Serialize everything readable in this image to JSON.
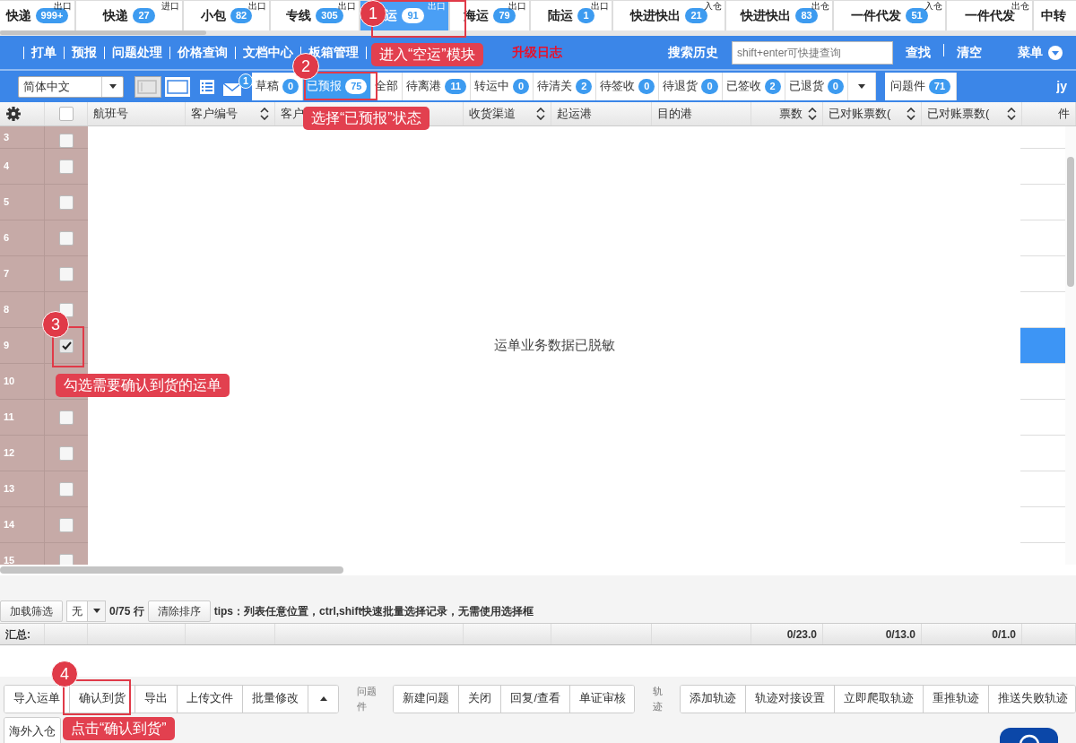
{
  "top_tabs": [
    {
      "label": "快递",
      "count": "999+",
      "tag": "出口",
      "selected": false
    },
    {
      "label": "快递",
      "count": "27",
      "tag": "进口",
      "selected": false
    },
    {
      "label": "小包",
      "count": "82",
      "tag": "出口",
      "selected": false
    },
    {
      "label": "专线",
      "count": "305",
      "tag": "出口",
      "selected": false
    },
    {
      "label": "运",
      "count": "91",
      "tag": "出口",
      "selected": true
    },
    {
      "label": "海运",
      "count": "79",
      "tag": "出口",
      "selected": false
    },
    {
      "label": "陆运",
      "count": "1",
      "tag": "出口",
      "selected": false
    },
    {
      "label": "快进快出",
      "count": "21",
      "tag": "入仓",
      "selected": false
    },
    {
      "label": "快进快出",
      "count": "83",
      "tag": "出仓",
      "selected": false
    },
    {
      "label": "一件代发",
      "count": "51",
      "tag": "入仓",
      "selected": false
    },
    {
      "label": "一件代发",
      "tag": "出仓",
      "selected": false
    },
    {
      "label": "中转",
      "selected": false
    }
  ],
  "nav_menu": [
    "打单",
    "预报",
    "问题处理",
    "价格查询",
    "文档中心",
    "板箱管理"
  ],
  "nav_alert": "升级日志",
  "search": {
    "history": "搜索历史",
    "placeholder": "shift+enter可快捷查询",
    "find": "查找",
    "clear": "清空",
    "menu": "菜单"
  },
  "toolbar": {
    "language": "简体中文",
    "layouts": [
      {
        "selected": false
      },
      {
        "selected": true
      }
    ],
    "mail_count": "1",
    "status_tabs": [
      {
        "label": "草稿",
        "count": "0",
        "selected": false
      },
      {
        "label": "已预报",
        "count": "75",
        "selected": true
      },
      {
        "label": "全部",
        "selected": false
      },
      {
        "label": "待离港",
        "count": "11",
        "selected": false
      },
      {
        "label": "转运中",
        "count": "0",
        "selected": false
      },
      {
        "label": "待清关",
        "count": "2",
        "selected": false
      },
      {
        "label": "待签收",
        "count": "0",
        "selected": false
      },
      {
        "label": "待退货",
        "count": "0",
        "selected": false
      },
      {
        "label": "已签收",
        "count": "2",
        "selected": false
      },
      {
        "label": "已退货",
        "count": "0",
        "selected": false
      }
    ],
    "issues": {
      "label": "问题件",
      "count": "71"
    },
    "user": "jy"
  },
  "grid": {
    "select_all": {
      "checked": false
    },
    "columns": [
      {
        "label": "航班号",
        "sortable": false
      },
      {
        "label": "客户编号",
        "sortable": true
      },
      {
        "label": "客户",
        "sortable": false
      },
      {
        "label": "收货渠道",
        "sortable": true
      },
      {
        "label": "起运港",
        "sortable": false
      },
      {
        "label": "目的港",
        "sortable": false
      },
      {
        "label": "票数",
        "sortable": true,
        "total": "0/23.0"
      },
      {
        "label": "已对账票数(",
        "sortable": true,
        "total": "0/13.0"
      },
      {
        "label": "已对账票数(",
        "sortable": true,
        "total": "0/1.0"
      },
      {
        "label": "件",
        "sortable": false
      }
    ],
    "rows": [
      {
        "number": "3",
        "checked": false
      },
      {
        "number": "4",
        "checked": false
      },
      {
        "number": "5",
        "checked": false
      },
      {
        "number": "6",
        "checked": false
      },
      {
        "number": "7",
        "checked": false
      },
      {
        "number": "8",
        "checked": false
      },
      {
        "number": "9",
        "checked": true
      },
      {
        "number": "10"
      },
      {
        "number": "11",
        "checked": false
      },
      {
        "number": "12",
        "checked": false
      },
      {
        "number": "13",
        "checked": false
      },
      {
        "number": "14",
        "checked": false
      },
      {
        "number": "15",
        "checked": false
      }
    ],
    "message": "运单业务数据已脱敏"
  },
  "filter_bar": {
    "load_filter": "加载筛选",
    "filter_value": "无",
    "row_count": "0/75 行",
    "clear_sort": "清除排序",
    "tips": "tips：列表任意位置，ctrl,shift快速批量选择记录，无需使用选择框"
  },
  "summary_label": "汇总:",
  "action_groups": [
    {
      "buttons": [
        "导入运单",
        "确认到货",
        "导出",
        "上传文件",
        "批量修改"
      ],
      "more": true
    },
    {
      "label": "问题件",
      "buttons": [
        "新建问题",
        "关闭",
        "回复/查看",
        "单证审核"
      ]
    },
    {
      "label": "轨迹",
      "buttons": [
        "添加轨迹",
        "轨迹对接设置",
        "立即爬取轨迹",
        "重推轨迹",
        "推送失败轨迹"
      ]
    }
  ],
  "extra_buttons": [
    "海外入仓"
  ],
  "annotations": [
    {
      "number": "1",
      "text": "进入“空运”模块"
    },
    {
      "number": "2",
      "text": "选择“已预报”状态"
    },
    {
      "number": "3",
      "text": "勾选需要确认到货的运单"
    },
    {
      "number": "4",
      "text": "点击“确认到货”"
    }
  ]
}
